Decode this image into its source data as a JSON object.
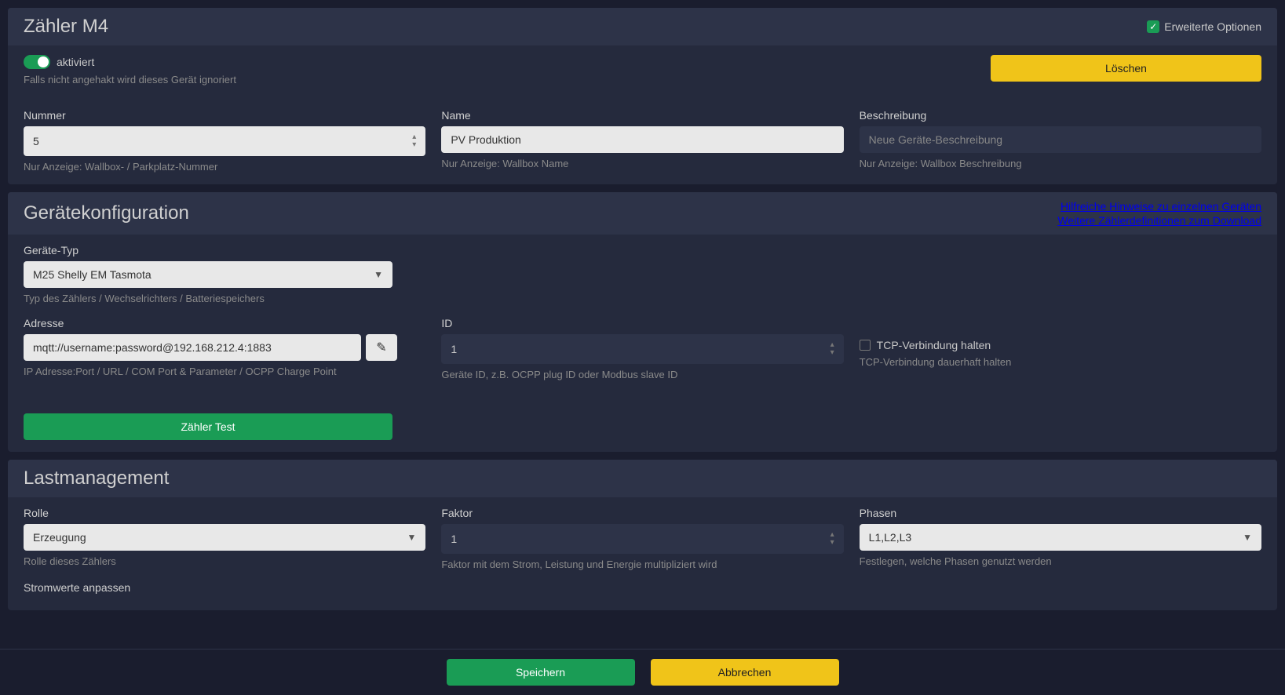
{
  "header": {
    "title": "Zähler M4",
    "advanced_label": "Erweiterte Optionen"
  },
  "activation": {
    "enabled_label": "aktiviert",
    "enabled_help": "Falls nicht angehakt wird dieses Gerät ignoriert",
    "delete_label": "Löschen"
  },
  "basic": {
    "number_label": "Nummer",
    "number_value": "5",
    "number_help": "Nur Anzeige: Wallbox- / Parkplatz-Nummer",
    "name_label": "Name",
    "name_value": "PV Produktion",
    "name_help": "Nur Anzeige: Wallbox Name",
    "desc_label": "Beschreibung",
    "desc_placeholder": "Neue Geräte-Beschreibung",
    "desc_help": "Nur Anzeige: Wallbox Beschreibung"
  },
  "config": {
    "title": "Gerätekonfiguration",
    "link1": "Hilfreiche Hinweise zu einzelnen Geräten",
    "link2": "Weitere Zählerdefinitionen zum Download",
    "type_label": "Geräte-Typ",
    "type_value": "M25 Shelly EM Tasmota",
    "type_help": "Typ des Zählers / Wechselrichters / Batteriespeichers",
    "address_label": "Adresse",
    "address_value": "mqtt://username:password@192.168.212.4:1883",
    "address_help": "IP Adresse:Port / URL / COM Port & Parameter / OCPP Charge Point",
    "id_label": "ID",
    "id_value": "1",
    "id_help": "Geräte ID, z.B. OCPP plug ID oder Modbus slave ID",
    "tcp_label": "TCP-Verbindung halten",
    "tcp_help": "TCP-Verbindung dauerhaft halten",
    "test_label": "Zähler Test"
  },
  "load": {
    "title": "Lastmanagement",
    "role_label": "Rolle",
    "role_value": "Erzeugung",
    "role_help": "Rolle dieses Zählers",
    "factor_label": "Faktor",
    "factor_value": "1",
    "factor_help": "Faktor mit dem Strom, Leistung und Energie multipliziert wird",
    "phases_label": "Phasen",
    "phases_value": "L1,L2,L3",
    "phases_help": "Festlegen, welche Phasen genutzt werden",
    "adjust_label": "Stromwerte anpassen"
  },
  "footer": {
    "save": "Speichern",
    "cancel": "Abbrechen"
  }
}
